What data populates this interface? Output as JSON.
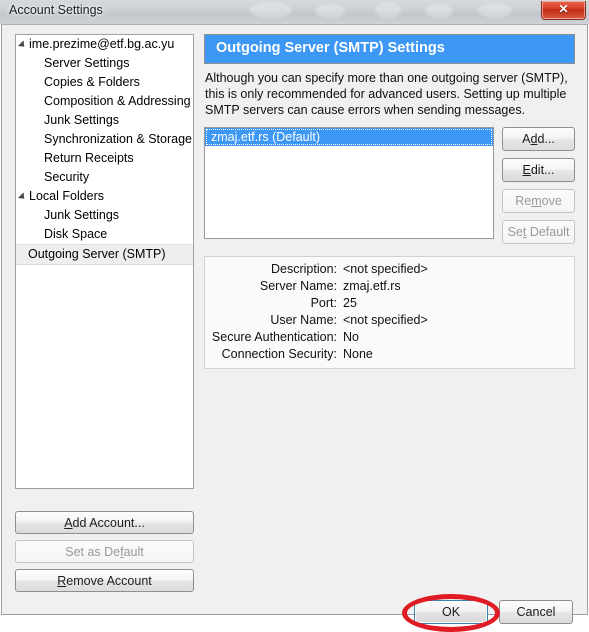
{
  "window": {
    "title": "Account Settings",
    "close_label": "✕",
    "close_icon": "close-icon"
  },
  "sidebar": {
    "items": [
      {
        "label": "ime.prezime@etf.bg.ac.yu",
        "level": "root",
        "twisty": true,
        "selected": false
      },
      {
        "label": "Server Settings",
        "level": "child",
        "twisty": false,
        "selected": false
      },
      {
        "label": "Copies & Folders",
        "level": "child",
        "twisty": false,
        "selected": false
      },
      {
        "label": "Composition & Addressing",
        "level": "child",
        "twisty": false,
        "selected": false
      },
      {
        "label": "Junk Settings",
        "level": "child",
        "twisty": false,
        "selected": false
      },
      {
        "label": "Synchronization & Storage",
        "level": "child",
        "twisty": false,
        "selected": false
      },
      {
        "label": "Return Receipts",
        "level": "child",
        "twisty": false,
        "selected": false
      },
      {
        "label": "Security",
        "level": "child",
        "twisty": false,
        "selected": false
      },
      {
        "label": "Local Folders",
        "level": "root",
        "twisty": true,
        "selected": false
      },
      {
        "label": "Junk Settings",
        "level": "child",
        "twisty": false,
        "selected": false
      },
      {
        "label": "Disk Space",
        "level": "child",
        "twisty": false,
        "selected": false
      },
      {
        "label": "Outgoing Server (SMTP)",
        "level": "root",
        "twisty": false,
        "selected": true
      }
    ],
    "buttons": {
      "add_account": "Add Account...",
      "add_account_accesskey": "A",
      "set_as_default": "Set as Default",
      "set_as_default_accesskey": "f",
      "set_as_default_enabled": false,
      "remove_account": "Remove Account",
      "remove_account_accesskey": "R"
    }
  },
  "main": {
    "header_title": "Outgoing Server (SMTP) Settings",
    "header_color": "#3d97f5",
    "description": "Although you can specify more than one outgoing server (SMTP), this is only recommended for advanced users. Setting up multiple SMTP servers can cause errors when sending messages.",
    "server_list": [
      {
        "label": "zmaj.etf.rs (Default)",
        "selected": true
      }
    ],
    "list_buttons": {
      "add": "Add...",
      "add_accesskey": "d",
      "edit": "Edit...",
      "edit_accesskey": "E",
      "remove": "Remove",
      "remove_accesskey": "m",
      "remove_enabled": false,
      "set_default": "Set Default",
      "set_default_accesskey": "t",
      "set_default_enabled": false
    },
    "details": {
      "rows": [
        {
          "key": "Description:",
          "value": "<not specified>"
        },
        {
          "key": "Server Name:",
          "value": "zmaj.etf.rs"
        },
        {
          "key": "Port:",
          "value": "25"
        },
        {
          "key": "User Name:",
          "value": "<not specified>"
        },
        {
          "key": "Secure Authentication:",
          "value": "No"
        },
        {
          "key": "Connection Security:",
          "value": "None"
        }
      ]
    }
  },
  "footer": {
    "ok": "OK",
    "cancel": "Cancel",
    "ok_focused": true,
    "annotation_color": "#e01b24"
  }
}
